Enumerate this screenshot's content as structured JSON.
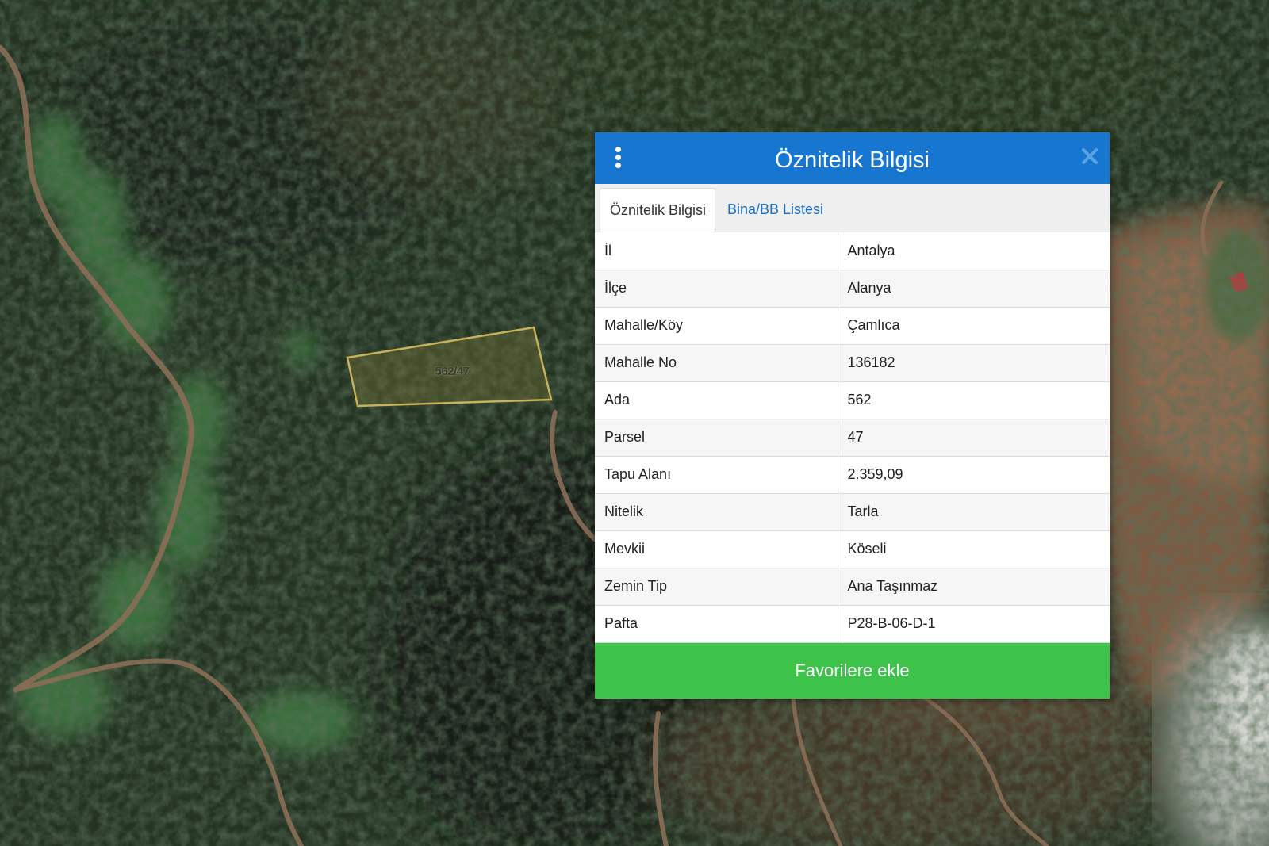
{
  "map": {
    "parcel_label": "562/47",
    "colors": {
      "forest_dark": "#1f2c1d",
      "forest_light": "#3a6b3a",
      "bare_ground": "#7a5a42",
      "road": "#8a6e56",
      "parcel_outline": "#c8b25a",
      "parcel_fill": "#6b6a34"
    }
  },
  "panel": {
    "title": "Öznitelik Bilgisi",
    "menu_icon": "vertical-dots-icon",
    "close_icon": "close-icon",
    "header_color": "#1676d0",
    "tabs": [
      {
        "label": "Öznitelik Bilgisi",
        "active": true
      },
      {
        "label": "Bina/BB Listesi",
        "active": false
      }
    ],
    "rows": [
      {
        "key": "İl",
        "value": "Antalya"
      },
      {
        "key": "İlçe",
        "value": "Alanya"
      },
      {
        "key": "Mahalle/Köy",
        "value": "Çamlıca"
      },
      {
        "key": "Mahalle No",
        "value": "136182"
      },
      {
        "key": "Ada",
        "value": "562"
      },
      {
        "key": "Parsel",
        "value": "47"
      },
      {
        "key": "Tapu Alanı",
        "value": "2.359,09"
      },
      {
        "key": "Nitelik",
        "value": "Tarla"
      },
      {
        "key": "Mevkii",
        "value": "Köseli"
      },
      {
        "key": "Zemin Tip",
        "value": "Ana Taşınmaz"
      },
      {
        "key": "Pafta",
        "value": "P28-B-06-D-1"
      }
    ],
    "favorite_button": "Favorilere ekle",
    "favorite_color": "#3ec34a"
  }
}
